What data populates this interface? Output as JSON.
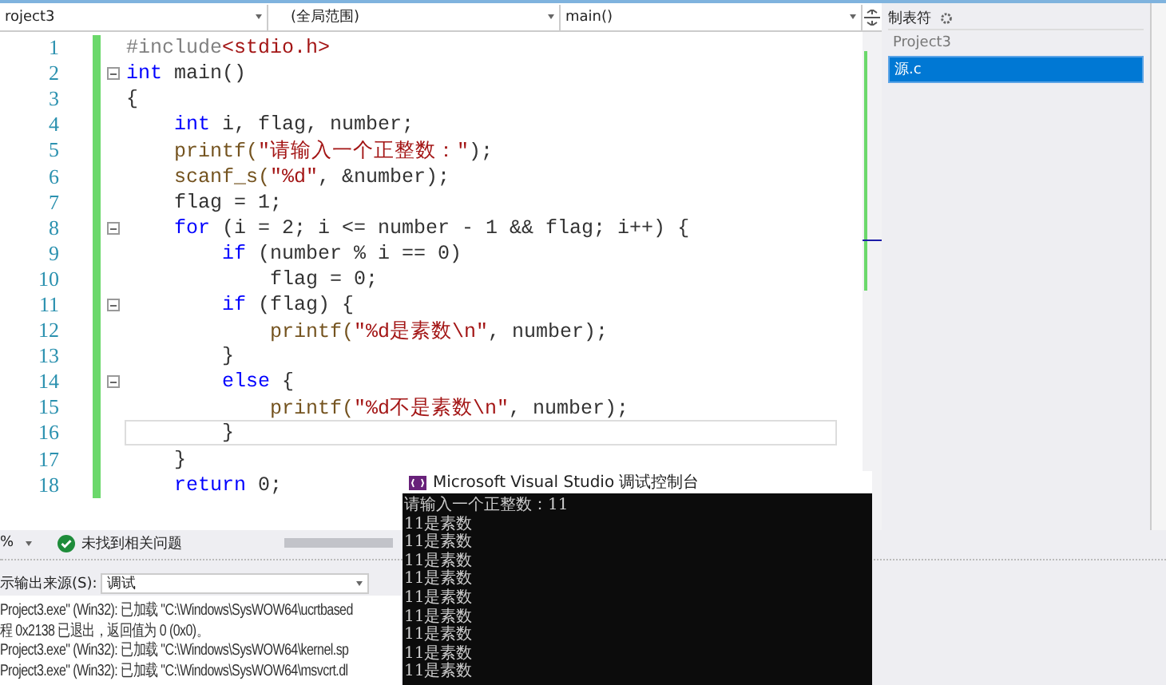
{
  "toolbar": {
    "project": "roject3",
    "scope": "(全局范围)",
    "member": "main()"
  },
  "editor": {
    "lines": [
      {
        "number": "1",
        "fold": false,
        "current": false,
        "code": [
          {
            "t": "#include",
            "kind": "pre"
          },
          {
            "t": "<stdio.h>",
            "kind": "str"
          }
        ]
      },
      {
        "number": "2",
        "fold": true,
        "current": false,
        "code": [
          {
            "t": "int",
            "kind": "kw"
          },
          {
            "t": " main()",
            "kind": "txt"
          }
        ]
      },
      {
        "number": "3",
        "fold": false,
        "current": false,
        "code": [
          {
            "t": "{",
            "kind": "txt"
          }
        ]
      },
      {
        "number": "4",
        "fold": false,
        "current": false,
        "code": [
          {
            "t": "    int",
            "kind": "kw"
          },
          {
            "t": " i, flag, number;",
            "kind": "txt"
          }
        ]
      },
      {
        "number": "5",
        "fold": false,
        "current": false,
        "code": [
          {
            "t": "    printf(",
            "kind": "fn"
          },
          {
            "t": "\"请输入一个正整数：\"",
            "kind": "str"
          },
          {
            "t": ");",
            "kind": "txt"
          }
        ]
      },
      {
        "number": "6",
        "fold": false,
        "current": false,
        "code": [
          {
            "t": "    scanf_s(",
            "kind": "fn"
          },
          {
            "t": "\"%d\"",
            "kind": "str"
          },
          {
            "t": ", &number);",
            "kind": "txt"
          }
        ]
      },
      {
        "number": "7",
        "fold": false,
        "current": false,
        "code": [
          {
            "t": "    flag = 1;",
            "kind": "txt"
          }
        ]
      },
      {
        "number": "8",
        "fold": true,
        "current": false,
        "code": [
          {
            "t": "    for",
            "kind": "kw"
          },
          {
            "t": " (i = 2; i <= number - 1 && flag; i++) {",
            "kind": "txt"
          }
        ]
      },
      {
        "number": "9",
        "fold": false,
        "current": false,
        "code": [
          {
            "t": "        if",
            "kind": "kw"
          },
          {
            "t": " (number % i == 0)",
            "kind": "txt"
          }
        ]
      },
      {
        "number": "10",
        "fold": false,
        "current": false,
        "code": [
          {
            "t": "            flag = 0;",
            "kind": "txt"
          }
        ]
      },
      {
        "number": "11",
        "fold": true,
        "current": false,
        "code": [
          {
            "t": "        if",
            "kind": "kw"
          },
          {
            "t": " (flag) {",
            "kind": "txt"
          }
        ]
      },
      {
        "number": "12",
        "fold": false,
        "current": false,
        "code": [
          {
            "t": "            printf(",
            "kind": "fn"
          },
          {
            "t": "\"%d是素数\\n\"",
            "kind": "str"
          },
          {
            "t": ", number);",
            "kind": "txt"
          }
        ]
      },
      {
        "number": "13",
        "fold": false,
        "current": false,
        "code": [
          {
            "t": "        }",
            "kind": "txt"
          }
        ]
      },
      {
        "number": "14",
        "fold": true,
        "current": false,
        "code": [
          {
            "t": "        else",
            "kind": "kw"
          },
          {
            "t": " {",
            "kind": "txt"
          }
        ]
      },
      {
        "number": "15",
        "fold": false,
        "current": false,
        "code": [
          {
            "t": "            printf(",
            "kind": "fn"
          },
          {
            "t": "\"%d不是素数\\n\"",
            "kind": "str"
          },
          {
            "t": ", number);",
            "kind": "txt"
          }
        ]
      },
      {
        "number": "16",
        "fold": false,
        "current": true,
        "code": [
          {
            "t": "        }",
            "kind": "txt"
          }
        ]
      },
      {
        "number": "17",
        "fold": false,
        "current": false,
        "code": [
          {
            "t": "    }",
            "kind": "txt"
          }
        ]
      },
      {
        "number": "18",
        "fold": false,
        "current": false,
        "code": [
          {
            "t": "    return",
            "kind": "kw"
          },
          {
            "t": " 0;",
            "kind": "txt"
          }
        ]
      }
    ]
  },
  "solution_panel": {
    "title": "制表符",
    "items": [
      {
        "label": "Project3",
        "selected": false
      },
      {
        "label": "源.c",
        "selected": true
      }
    ]
  },
  "status_bar": {
    "zoom": "%",
    "issues": "未找到相关问题"
  },
  "output": {
    "source_label": "示输出来源(S):",
    "source": "调试",
    "lines": [
      "Project3.exe\" (Win32): 已加载 \"C:\\Windows\\SysWOW64\\ucrtbased",
      "程 0x2138 已退出，返回值为 0 (0x0)。",
      "Project3.exe\" (Win32): 已加载 \"C:\\Windows\\SysWOW64\\kernel.sp",
      "Project3.exe\" (Win32): 已加载 \"C:\\Windows\\SysWOW64\\msvcrt.dl"
    ]
  },
  "console": {
    "title": "Microsoft Visual Studio 调试控制台",
    "lines": [
      "请输入一个正整数：11",
      "11是素数",
      "11是素数",
      "11是素数",
      "11是素数",
      "11是素数",
      "11是素数",
      "11是素数",
      "11是素数",
      "11是素数"
    ]
  }
}
